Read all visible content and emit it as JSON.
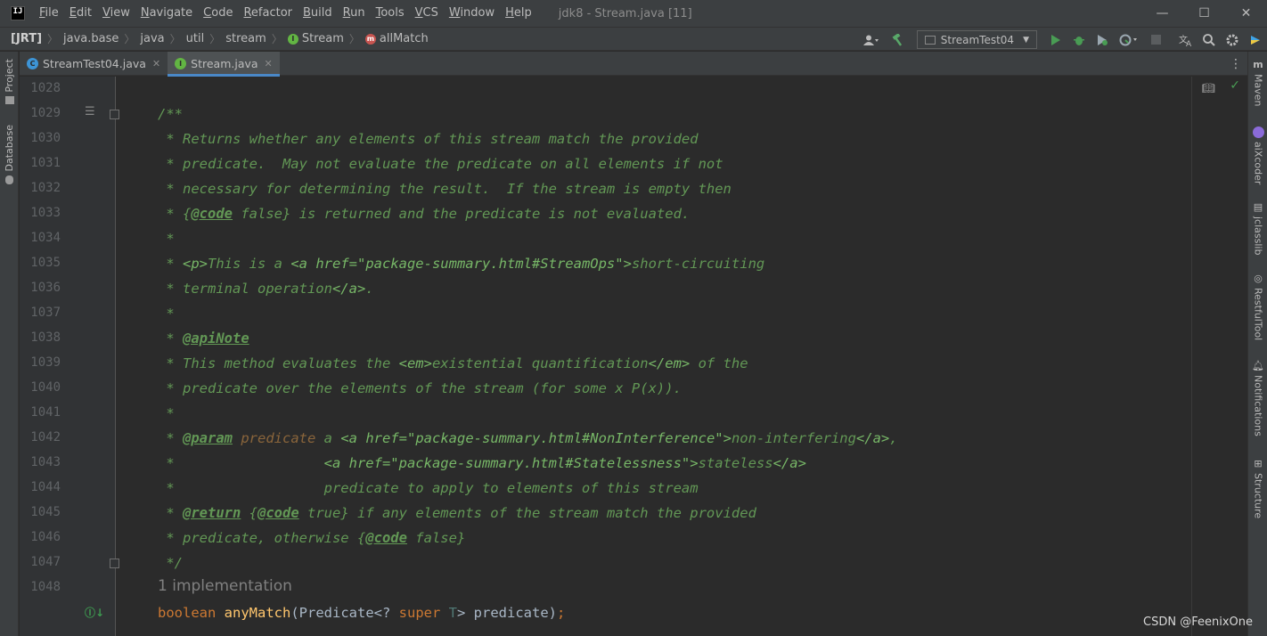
{
  "app": {
    "logo_text": "IJ",
    "window_title": "jdk8 - Stream.java [11]",
    "menu": [
      {
        "label": "File",
        "mnemonic": "F",
        "rest": "ile"
      },
      {
        "label": "Edit",
        "mnemonic": "E",
        "rest": "dit"
      },
      {
        "label": "View",
        "mnemonic": "V",
        "rest": "iew"
      },
      {
        "label": "Navigate",
        "mnemonic": "N",
        "rest": "avigate"
      },
      {
        "label": "Code",
        "mnemonic": "C",
        "rest": "ode"
      },
      {
        "label": "Refactor",
        "mnemonic": "R",
        "rest": "efactor"
      },
      {
        "label": "Build",
        "mnemonic": "B",
        "rest": "uild"
      },
      {
        "label": "Run",
        "mnemonic": "R",
        "rest": "un"
      },
      {
        "label": "Tools",
        "mnemonic": "T",
        "rest": "ools"
      },
      {
        "label": "VCS",
        "mnemonic": "V",
        "rest": "CS"
      },
      {
        "label": "Window",
        "mnemonic": "W",
        "rest": "indow"
      },
      {
        "label": "Help",
        "mnemonic": "H",
        "rest": "elp"
      }
    ],
    "window_controls": {
      "minimize": "—",
      "maximize": "☐",
      "close": "✕"
    }
  },
  "breadcrumb": {
    "items": [
      "[JRT]",
      "java.base",
      "java",
      "util",
      "stream",
      "Stream",
      "allMatch"
    ],
    "separator": "〉"
  },
  "toolbar": {
    "run_config": "StreamTest04",
    "icons": [
      "user-icon",
      "build-hammer-icon",
      "run-icon",
      "debug-icon",
      "coverage-icon",
      "profile-icon",
      "stop-icon",
      "translate-icon",
      "search-icon",
      "settings-icon",
      "plugin-icon"
    ]
  },
  "left_tools": {
    "project": "Project",
    "database": "Database"
  },
  "right_tools": {
    "maven": "Maven",
    "aixcoder": "aiXcoder",
    "jclasslib": "jclasslib",
    "restful": "RestfulTool",
    "notifications": "Notifications",
    "structure": "Structure"
  },
  "tabs": [
    {
      "label": "StreamTest04.java",
      "active": false
    },
    {
      "label": "Stream.java",
      "active": true
    }
  ],
  "editor": {
    "line_numbers": [
      "1028",
      "1029",
      "1030",
      "1031",
      "1032",
      "1033",
      "1034",
      "1035",
      "1036",
      "1037",
      "1038",
      "1039",
      "1040",
      "1041",
      "1042",
      "1043",
      "1044",
      "1045",
      "1046",
      "1047",
      "1048"
    ],
    "implementation_hint": "1 implementation",
    "lines": {
      "l1029": "/**",
      "l1030": " * Returns whether any elements of this stream match the provided",
      "l1031": " * predicate.  May not evaluate the predicate on all elements if not",
      "l1032": " * necessary for determining the result.  If the stream is empty then",
      "l1033_a": " * {",
      "l1033_tag": "@code",
      "l1033_b": " false} is returned and the predicate is not evaluated.",
      "l1034": " *",
      "l1035_a": " * ",
      "l1035_m1": "<p>",
      "l1035_b": "This is a ",
      "l1035_m2": "<a href=\"package-summary.html#StreamOps\">",
      "l1035_c": "short-circuiting",
      "l1036_a": " * terminal operation",
      "l1036_m": "</a>",
      "l1036_b": ".",
      "l1037": " *",
      "l1038_a": " * ",
      "l1038_tag": "@apiNote",
      "l1039_a": " * This method evaluates the ",
      "l1039_m1": "<em>",
      "l1039_b": "existential quantification",
      "l1039_m2": "</em>",
      "l1039_c": " of the",
      "l1040": " * predicate over the elements of the stream (for some x P(x)).",
      "l1041": " *",
      "l1042_a": " * ",
      "l1042_tag": "@param",
      "l1042_sp": " ",
      "l1042_p": "predicate",
      "l1042_b": " a ",
      "l1042_m1": "<a href=\"package-summary.html#NonInterference\">",
      "l1042_c": "non-interfering",
      "l1042_m2": "</a>",
      "l1042_d": ",",
      "l1043_a": " *                  ",
      "l1043_m1": "<a href=\"package-summary.html#Statelessness\">",
      "l1043_b": "stateless",
      "l1043_m2": "</a>",
      "l1044": " *                  predicate to apply to elements of this stream",
      "l1045_a": " * ",
      "l1045_tag": "@return",
      "l1045_b": " {",
      "l1045_tag2": "@code",
      "l1045_c": " true} if any elements of the stream match the provided",
      "l1046_a": " * predicate, otherwise {",
      "l1046_tag": "@code",
      "l1046_b": " false}",
      "l1047": " */",
      "l1048_kw": "boolean",
      "l1048_sp": " ",
      "l1048_fn": "anyMatch",
      "l1048_a": "(Predicate<? ",
      "l1048_kw2": "super",
      "l1048_sp2": " ",
      "l1048_t": "T",
      "l1048_b": "> predicate)",
      "l1048_semi": ";"
    }
  },
  "watermark": "CSDN @FeenixOne",
  "colors": {
    "background": "#2b2b2b",
    "doc_comment": "#629755",
    "keyword": "#cc7832",
    "method": "#ffc66d",
    "accent_tab": "#4a88c7"
  }
}
